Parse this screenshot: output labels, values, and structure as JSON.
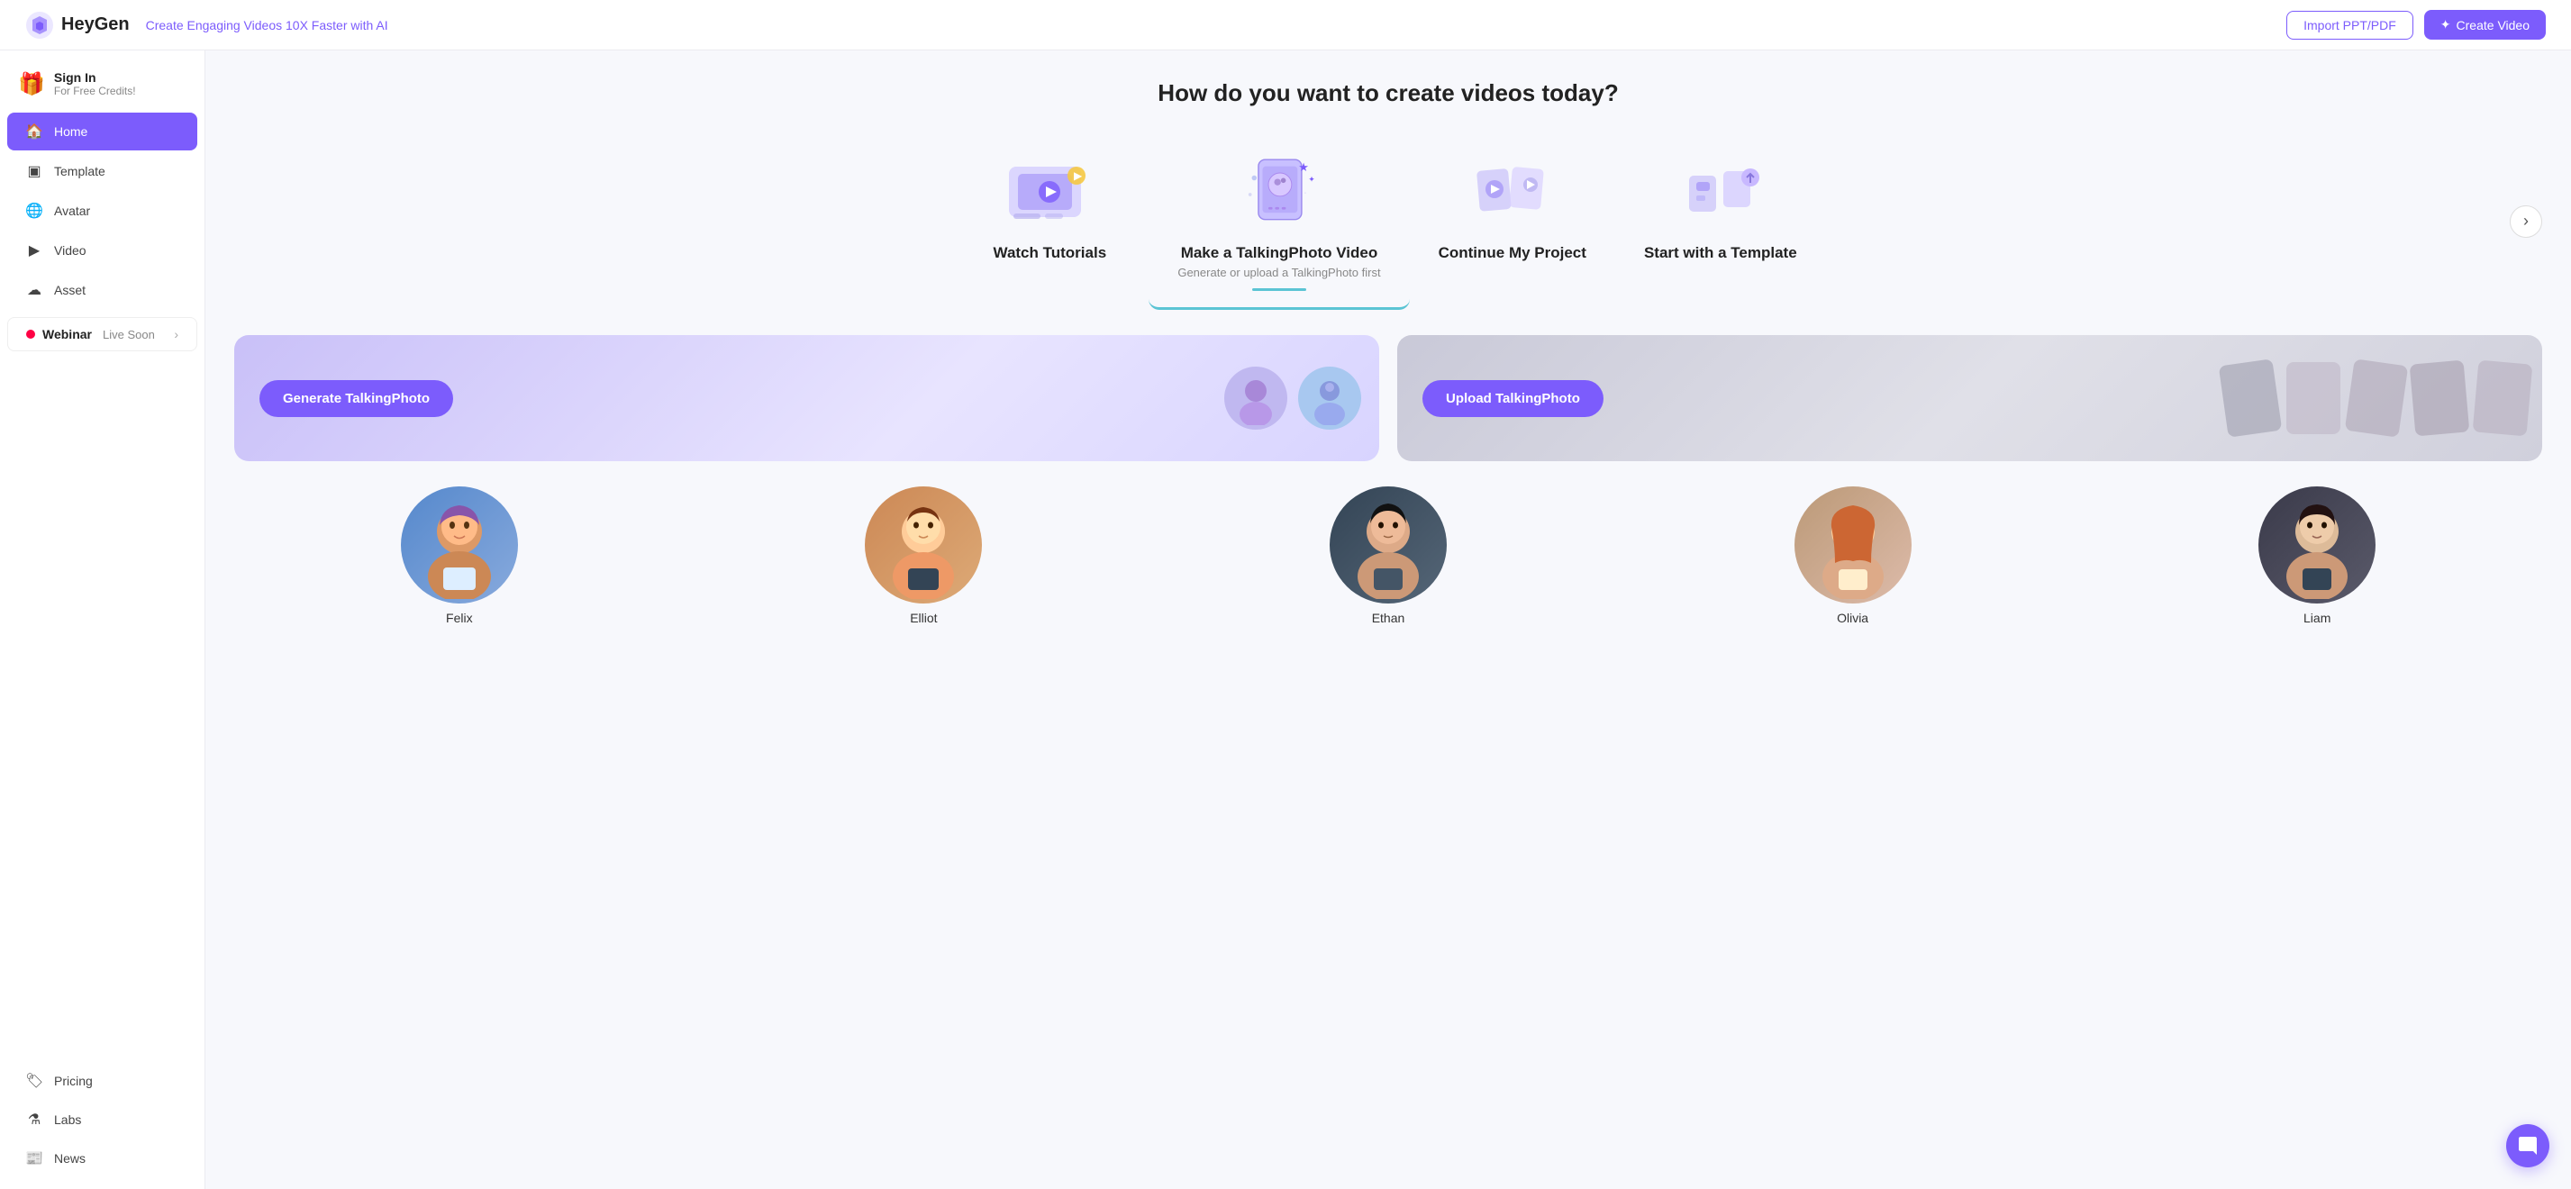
{
  "topnav": {
    "logo_text": "HeyGen",
    "tagline": "Create Engaging Videos 10X Faster with AI",
    "btn_import": "Import PPT/PDF",
    "btn_create": "Create Video"
  },
  "sidebar": {
    "sign_in": "Sign In",
    "sign_in_sub": "For Free Credits!",
    "items": [
      {
        "id": "home",
        "label": "Home",
        "icon": "🏠",
        "active": true
      },
      {
        "id": "template",
        "label": "Template",
        "icon": "▢"
      },
      {
        "id": "avatar",
        "label": "Avatar",
        "icon": "🌐"
      },
      {
        "id": "video",
        "label": "Video",
        "icon": "▶"
      },
      {
        "id": "asset",
        "label": "Asset",
        "icon": "☁"
      }
    ],
    "webinar": {
      "label": "Webinar",
      "soon": "Live Soon"
    },
    "bottom_items": [
      {
        "id": "pricing",
        "label": "Pricing",
        "icon": "🏷"
      },
      {
        "id": "labs",
        "label": "Labs",
        "icon": "⚗"
      },
      {
        "id": "news",
        "label": "News",
        "icon": "📰"
      }
    ]
  },
  "main": {
    "section_title": "How do you want to create videos today?",
    "cards": [
      {
        "id": "watch-tutorials",
        "title": "Watch Tutorials",
        "sub": "",
        "active": false
      },
      {
        "id": "talking-photo",
        "title": "Make a TalkingPhoto Video",
        "sub": "Generate or upload a TalkingPhoto first",
        "active": true
      },
      {
        "id": "continue-project",
        "title": "Continue My Project",
        "sub": "",
        "active": false
      },
      {
        "id": "start-template",
        "title": "Start with a Template",
        "sub": "",
        "active": false
      }
    ],
    "panels": {
      "generate_label": "Generate TalkingPhoto",
      "upload_label": "Upload TalkingPhoto"
    },
    "avatars": [
      {
        "id": "felix",
        "name": "Felix",
        "color_class": "felix"
      },
      {
        "id": "elliot",
        "name": "Elliot",
        "color_class": "elliot"
      },
      {
        "id": "ethan",
        "name": "Ethan",
        "color_class": "ethan"
      },
      {
        "id": "olivia",
        "name": "Olivia",
        "color_class": "olivia"
      },
      {
        "id": "liam",
        "name": "Liam",
        "color_class": "liam"
      }
    ]
  }
}
